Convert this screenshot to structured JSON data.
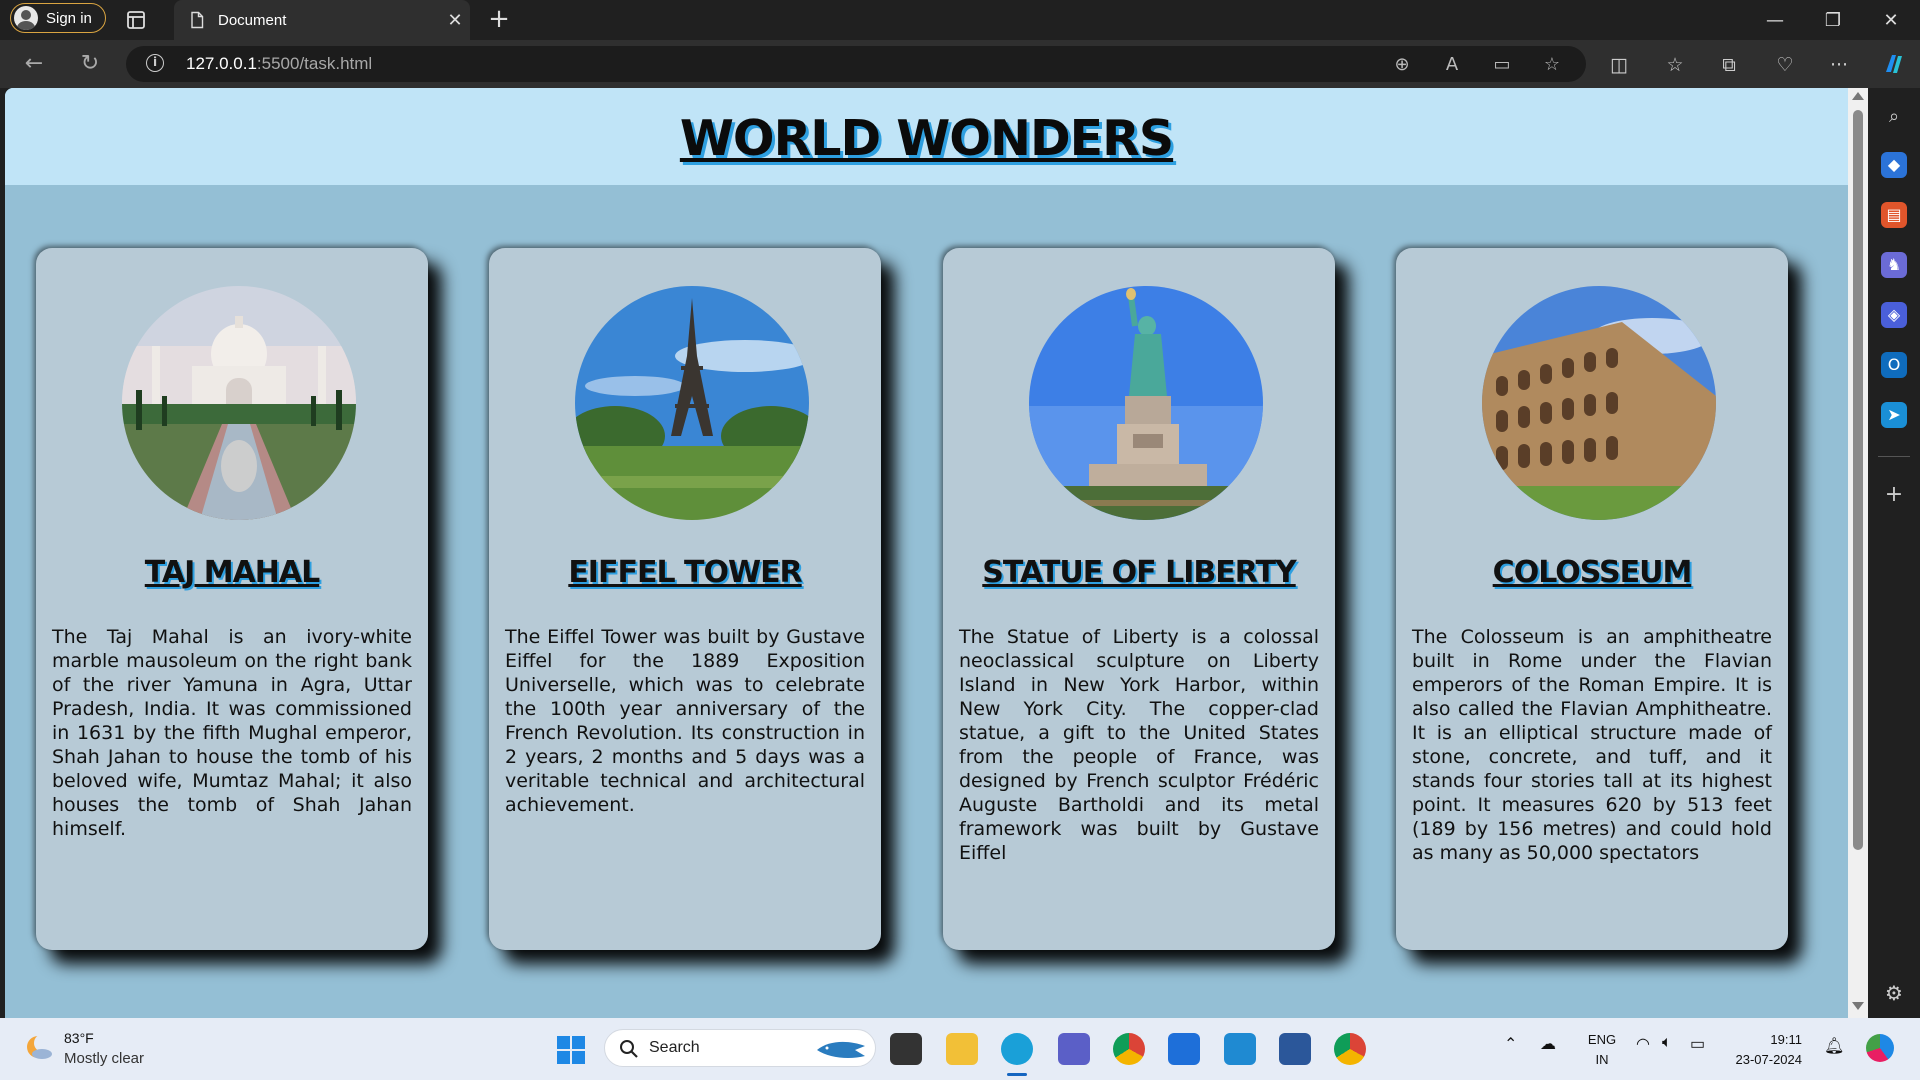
{
  "browser": {
    "sign_in_label": "Sign in",
    "tab_title": "Document",
    "url_host": "127.0.0.1",
    "url_rest": ":5500/task.html"
  },
  "page": {
    "title": "WORLD WONDERS",
    "cards": [
      {
        "title": "TAJ MAHAL",
        "image": "taj-mahal-photo",
        "text": "The Taj Mahal is an ivory-white marble mausoleum on the right bank of the river Yamuna in Agra, Uttar Pradesh, India. It was commissioned in 1631 by the fifth Mughal emperor, Shah Jahan to house the tomb of his beloved wife, Mumtaz Mahal; it also houses the tomb of Shah Jahan himself."
      },
      {
        "title": "EIFFEL TOWER",
        "image": "eiffel-tower-photo",
        "text": "The Eiffel Tower was built by Gustave Eiffel for the 1889 Exposition Universelle, which was to celebrate the 100th year anniversary of the French Revolution. Its construction in 2 years, 2 months and 5 days was a veritable technical and architectural achievement."
      },
      {
        "title": "STATUE OF LIBERTY",
        "image": "statue-of-liberty-photo",
        "text": "The Statue of Liberty is a colossal neoclassical sculpture on Liberty Island in New York Harbor, within New York City. The copper-clad statue, a gift to the United States from the people of France, was designed by French sculptor Frédéric Auguste Bartholdi and its metal framework was built by Gustave Eiffel"
      },
      {
        "title": "COLOSSEUM",
        "image": "colosseum-photo",
        "text": "The Colosseum is an amphitheatre built in Rome under the Flavian emperors of the Roman Empire. It is also called the Flavian Amphitheatre. It is an elliptical structure made of stone, concrete, and tuff, and it stands four stories tall at its highest point. It measures 620 by 513 feet (189 by 156 metres) and could hold as many as 50,000 spectators"
      }
    ]
  },
  "taskbar": {
    "weather_temp": "83°F",
    "weather_condition": "Mostly clear",
    "search_label": "Search",
    "lang_primary": "ENG",
    "lang_secondary": "IN",
    "time": "19:11",
    "date": "23-07-2024"
  },
  "colors": {
    "page_bg": "#94bfd5",
    "header_bg": "#c0e4f7",
    "card_bg": "#b7cad6",
    "title_shadow": "#2d9fe0"
  }
}
